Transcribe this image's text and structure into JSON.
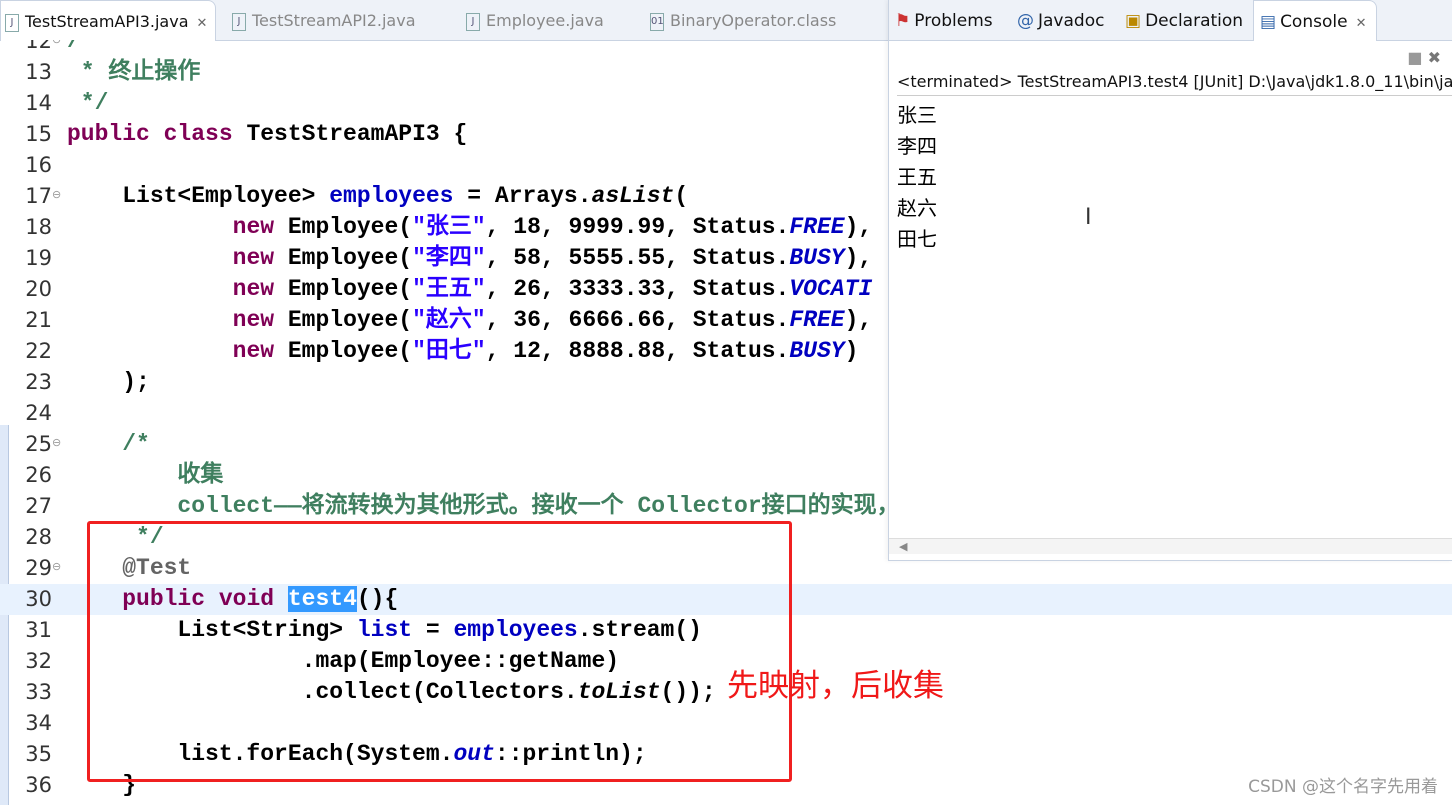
{
  "editor_tabs": [
    {
      "label": "TestStreamAPI3.java",
      "icon": "java-file-icon",
      "active": true
    },
    {
      "label": "TestStreamAPI2.java",
      "icon": "java-file-icon"
    },
    {
      "label": "Employee.java",
      "icon": "java-file-icon"
    },
    {
      "label": "BinaryOperator.class",
      "icon": "class-file-icon"
    }
  ],
  "code_lines": [
    {
      "n": "12",
      "fold": true,
      "tokens": [
        {
          "t": "/*",
          "c": "c"
        }
      ]
    },
    {
      "n": "13",
      "tokens": [
        {
          "t": " * 终止操作",
          "c": "c"
        }
      ]
    },
    {
      "n": "14",
      "tokens": [
        {
          "t": " */",
          "c": "c"
        }
      ]
    },
    {
      "n": "15",
      "tokens": [
        {
          "t": "public class ",
          "c": "k"
        },
        {
          "t": "TestStreamAPI3 {"
        }
      ]
    },
    {
      "n": "16",
      "tokens": []
    },
    {
      "n": "17",
      "fold": true,
      "tokens": [
        {
          "t": "    List<Employee> "
        },
        {
          "t": "employees",
          "c": "f"
        },
        {
          "t": " = Arrays."
        },
        {
          "t": "asList",
          "c": "i"
        },
        {
          "t": "("
        }
      ]
    },
    {
      "n": "18",
      "tokens": [
        {
          "t": "            "
        },
        {
          "t": "new",
          "c": "k"
        },
        {
          "t": " Employee("
        },
        {
          "t": "\"张三\"",
          "c": "s"
        },
        {
          "t": ", 18, 9999.99, Status."
        },
        {
          "t": "FREE",
          "c": "fi"
        },
        {
          "t": "),"
        }
      ]
    },
    {
      "n": "19",
      "tokens": [
        {
          "t": "            "
        },
        {
          "t": "new",
          "c": "k"
        },
        {
          "t": " Employee("
        },
        {
          "t": "\"李四\"",
          "c": "s"
        },
        {
          "t": ", 58, 5555.55, Status."
        },
        {
          "t": "BUSY",
          "c": "fi"
        },
        {
          "t": "),"
        }
      ]
    },
    {
      "n": "20",
      "tokens": [
        {
          "t": "            "
        },
        {
          "t": "new",
          "c": "k"
        },
        {
          "t": " Employee("
        },
        {
          "t": "\"王五\"",
          "c": "s"
        },
        {
          "t": ", 26, 3333.33, Status."
        },
        {
          "t": "VOCATI",
          "c": "fi"
        }
      ]
    },
    {
      "n": "21",
      "tokens": [
        {
          "t": "            "
        },
        {
          "t": "new",
          "c": "k"
        },
        {
          "t": " Employee("
        },
        {
          "t": "\"赵六\"",
          "c": "s"
        },
        {
          "t": ", 36, 6666.66, Status."
        },
        {
          "t": "FREE",
          "c": "fi"
        },
        {
          "t": "),"
        }
      ]
    },
    {
      "n": "22",
      "tokens": [
        {
          "t": "            "
        },
        {
          "t": "new",
          "c": "k"
        },
        {
          "t": " Employee("
        },
        {
          "t": "\"田七\"",
          "c": "s"
        },
        {
          "t": ", 12, 8888.88, Status."
        },
        {
          "t": "BUSY",
          "c": "fi"
        },
        {
          "t": ")"
        }
      ]
    },
    {
      "n": "23",
      "tokens": [
        {
          "t": "    );"
        }
      ]
    },
    {
      "n": "24",
      "tokens": []
    },
    {
      "n": "25",
      "fold": true,
      "tokens": [
        {
          "t": "    /*",
          "c": "c"
        }
      ]
    },
    {
      "n": "26",
      "tokens": [
        {
          "t": "        收集",
          "c": "c"
        }
      ]
    },
    {
      "n": "27",
      "tokens": [
        {
          "t": "        collect——将流转换为其他形式。接收一个 Collector接口的实现，",
          "c": "c"
        }
      ]
    },
    {
      "n": "28",
      "tokens": [
        {
          "t": "     */",
          "c": "c"
        }
      ]
    },
    {
      "n": "29",
      "fold": true,
      "tokens": [
        {
          "t": "    @Test",
          "c": "a"
        }
      ]
    },
    {
      "n": "30",
      "current": true,
      "tokens": [
        {
          "t": "    "
        },
        {
          "t": "public void ",
          "c": "k"
        },
        {
          "t": "test4",
          "c": "sel"
        },
        {
          "t": "(){"
        }
      ]
    },
    {
      "n": "31",
      "tokens": [
        {
          "t": "        List<String> "
        },
        {
          "t": "list",
          "c": "f"
        },
        {
          "t": " = "
        },
        {
          "t": "employees",
          "c": "f"
        },
        {
          "t": ".stream()"
        }
      ]
    },
    {
      "n": "32",
      "tokens": [
        {
          "t": "                 .map(Employee::getName)"
        }
      ]
    },
    {
      "n": "33",
      "tokens": [
        {
          "t": "                 .collect(Collectors."
        },
        {
          "t": "toList",
          "c": "i"
        },
        {
          "t": "());"
        }
      ]
    },
    {
      "n": "34",
      "tokens": []
    },
    {
      "n": "35",
      "tokens": [
        {
          "t": "        list.forEach(System."
        },
        {
          "t": "out",
          "c": "fi"
        },
        {
          "t": "::println);"
        }
      ]
    },
    {
      "n": "36",
      "tokens": [
        {
          "t": "    }"
        }
      ]
    }
  ],
  "console": {
    "tabs": [
      {
        "label": "Problems",
        "icon": "problems-icon"
      },
      {
        "label": "Javadoc",
        "icon": "at-icon"
      },
      {
        "label": "Declaration",
        "icon": "declaration-icon"
      },
      {
        "label": "Console",
        "icon": "console-icon",
        "active": true
      }
    ],
    "status": "<terminated> TestStreamAPI3.test4 [JUnit] D:\\Java\\jdk1.8.0_11\\bin\\ja",
    "output": [
      "张三",
      "李四",
      "王五",
      "赵六",
      "田七"
    ]
  },
  "annotation": "先映射，后收集",
  "watermark": "CSDN @这个名字先用着",
  "colors": {
    "keyword": "#7f0055",
    "comment": "#3f7f5f",
    "string": "#2a00ff",
    "field": "#0000c0",
    "selection": "#3399ff",
    "annotation_box": "#f02020"
  }
}
